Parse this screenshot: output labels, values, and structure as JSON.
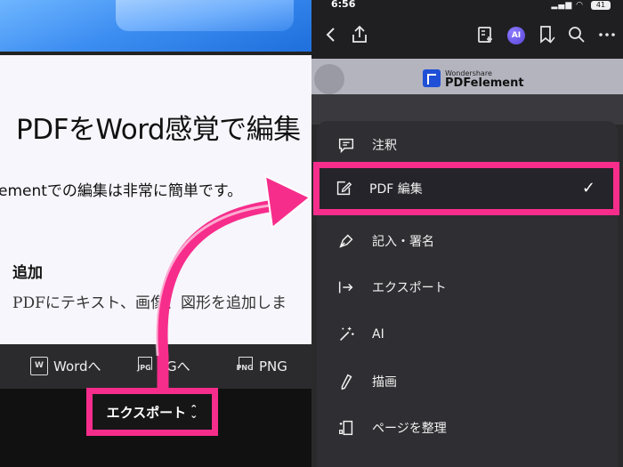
{
  "left": {
    "doc_title": "PDFをWord感覚で編集",
    "doc_line": "ementでの編集は非常に簡単です。",
    "doc_heading": "追加",
    "doc_body": "PDFにテキスト、画像、図形を追加しま",
    "convert_items": [
      {
        "icon": "W",
        "label": "Wordへ"
      },
      {
        "icon": "JPG",
        "label": "PGへ"
      },
      {
        "icon": "PNG",
        "label": "PNG"
      }
    ],
    "export_label": "エクスポート",
    "export_chevron": "⌃⌄"
  },
  "right": {
    "status_time": "6:56",
    "battery": "41",
    "brand_small": "Wondershare",
    "brand_big": "PDFelement",
    "ai_badge": "AI",
    "menu": [
      {
        "id": "annotate",
        "label": "注釈"
      },
      {
        "id": "pdf-edit",
        "label": "PDF 編集",
        "selected": true,
        "check": "✓"
      },
      {
        "id": "fill-sign",
        "label": "記入・署名"
      },
      {
        "id": "export",
        "label": "エクスポート"
      },
      {
        "id": "ai",
        "label": "AI"
      },
      {
        "id": "draw",
        "label": "描画"
      },
      {
        "id": "organize",
        "label": "ページを整理"
      }
    ]
  },
  "colors": {
    "highlight": "#f72d8c",
    "panel": "#2f2f33",
    "accent": "#5a46d8"
  }
}
